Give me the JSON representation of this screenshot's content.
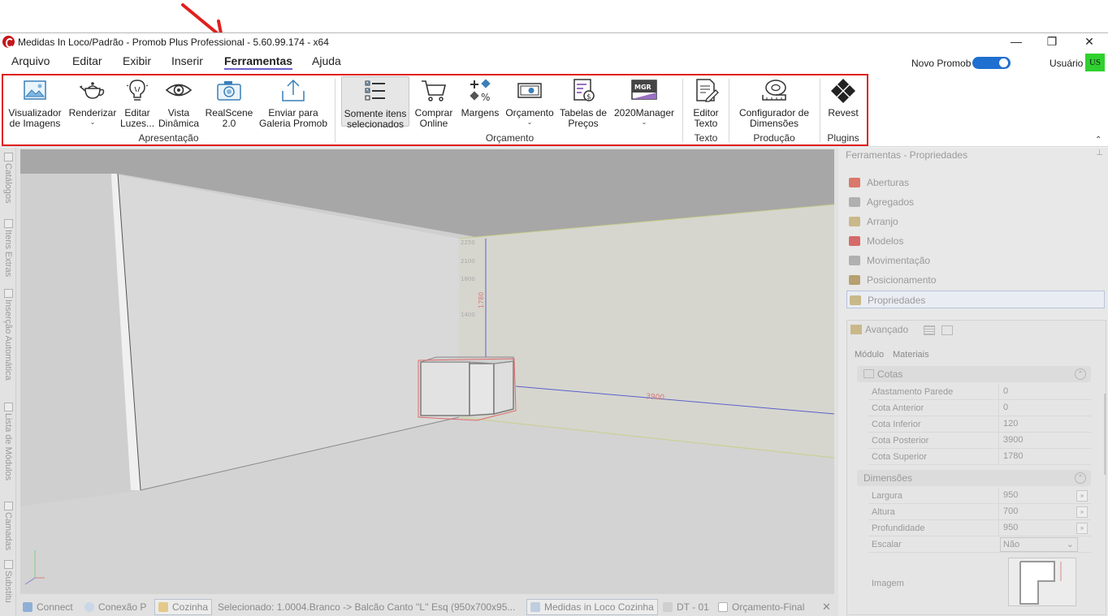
{
  "window": {
    "title": "Medidas In Loco/Padrão - Promob Plus Professional - 5.60.99.174 - x64",
    "minimize": "—",
    "restore": "❐",
    "close": "✕"
  },
  "menu": {
    "items": [
      "Arquivo",
      "Editar",
      "Exibir",
      "Inserir",
      "Ferramentas",
      "Ajuda"
    ],
    "active": "Ferramentas",
    "novo_promob_label": "Novo Promob",
    "novo_promob_on": true,
    "usuario_label": "Usuário",
    "user_initials": "US"
  },
  "ribbon": {
    "groups": [
      {
        "label": "Apresentação",
        "buttons": [
          {
            "label": "Visualizador\nde Imagens",
            "icon": "image-viewer-icon",
            "dropdown": false
          },
          {
            "label": "Renderizar",
            "icon": "teapot-icon",
            "dropdown": true
          },
          {
            "label": "Editar\nLuzes...",
            "icon": "light-bulb-icon",
            "dropdown": false
          },
          {
            "label": "Vista\nDinâmica",
            "icon": "eye-icon",
            "dropdown": false
          },
          {
            "label": "RealScene\n2.0",
            "icon": "camera-icon",
            "dropdown": true
          },
          {
            "label": "Enviar para\nGaleria Promob",
            "icon": "upload-icon",
            "dropdown": false
          }
        ]
      },
      {
        "label": "Orçamento",
        "buttons": [
          {
            "label": "Somente itens\nselecionados",
            "icon": "checklist-icon",
            "dropdown": false,
            "selected": true
          },
          {
            "label": "Comprar\nOnline",
            "icon": "cart-icon",
            "dropdown": true
          },
          {
            "label": "Margens",
            "icon": "percent-icon",
            "dropdown": false
          },
          {
            "label": "Orçamento",
            "icon": "money-icon",
            "dropdown": true
          },
          {
            "label": "Tabelas de\nPreços",
            "icon": "price-table-icon",
            "dropdown": false
          },
          {
            "label": "2020Manager",
            "icon": "mgr-icon",
            "dropdown": true,
            "icon_text": "MGR"
          }
        ]
      },
      {
        "label": "Texto",
        "buttons": [
          {
            "label": "Editor\nTexto",
            "icon": "text-editor-icon",
            "dropdown": false
          }
        ]
      },
      {
        "label": "Produção",
        "buttons": [
          {
            "label": "Configurador de\nDimensões",
            "icon": "tape-measure-icon",
            "dropdown": false
          }
        ]
      },
      {
        "label": "Plugins",
        "buttons": [
          {
            "label": "Revest",
            "icon": "diamond-tiles-icon",
            "dropdown": false
          }
        ]
      }
    ]
  },
  "left_dock": {
    "tabs": [
      "Catálogos",
      "Itens Extras",
      "Inserção Automática",
      "Lista de Módulos",
      "Camadas",
      "Substitu"
    ]
  },
  "viewport": {
    "dimension_labels": [
      "1780",
      "3900"
    ],
    "small_labels": [
      "2250",
      "2100",
      "1800",
      "1400"
    ]
  },
  "statusbar": {
    "connect": "Connect",
    "conexao": "Conexão P",
    "cozinha": "Cozinha",
    "selected": "Selecionado: 1.0004.Branco -> Balcão Canto ''L'' Esq (950x700x95...",
    "tab_active": "Medidas in Loco Cozinha",
    "tab_dt": "DT - 01",
    "tab_orcamento": "Orçamento-Final",
    "close": "✕"
  },
  "right_panel": {
    "title": "Ferramentas - Propriedades",
    "pin": "⊥",
    "items": [
      {
        "label": "Aberturas",
        "icon": "openings-icon",
        "color": "#d9786b"
      },
      {
        "label": "Agregados",
        "icon": "aggregates-icon",
        "color": "#9a9a9a"
      },
      {
        "label": "Arranjo",
        "icon": "arrangement-icon",
        "color": "#c9b88a"
      },
      {
        "label": "Modelos",
        "icon": "models-icon",
        "color": "#d66a6a"
      },
      {
        "label": "Movimentação",
        "icon": "move-icon",
        "color": "#9a9a9a"
      },
      {
        "label": "Posicionamento",
        "icon": "positioning-icon",
        "color": "#b8a070"
      },
      {
        "label": "Propriedades",
        "icon": "properties-icon",
        "color": "#c9b88a",
        "selected": true
      }
    ],
    "advanced": {
      "label": "Avançado",
      "tabs": [
        "Módulo",
        "Materiais"
      ],
      "sections": [
        {
          "title": "Cotas",
          "rows": [
            {
              "key": "Afastamento Parede",
              "value": "0"
            },
            {
              "key": "Cota Anterior",
              "value": "0"
            },
            {
              "key": "Cota Inferior",
              "value": "120"
            },
            {
              "key": "Cota Posterior",
              "value": "3900"
            },
            {
              "key": "Cota Superior",
              "value": "1780"
            }
          ]
        },
        {
          "title": "Dimensões",
          "rows": [
            {
              "key": "Largura",
              "value": "950",
              "button": "»"
            },
            {
              "key": "Altura",
              "value": "700",
              "button": "»"
            },
            {
              "key": "Profundidade",
              "value": "950",
              "button": "»"
            },
            {
              "key": "Escalar",
              "value": "Não",
              "select": true
            }
          ]
        }
      ],
      "image_label": "Imagem"
    }
  },
  "colors": {
    "accent": "#1e6fd0",
    "highlight_box": "#e0201e",
    "annotation_arrow": "#e0201e",
    "avatar": "#2fd12f",
    "menu_underline": "#6b62c9"
  }
}
